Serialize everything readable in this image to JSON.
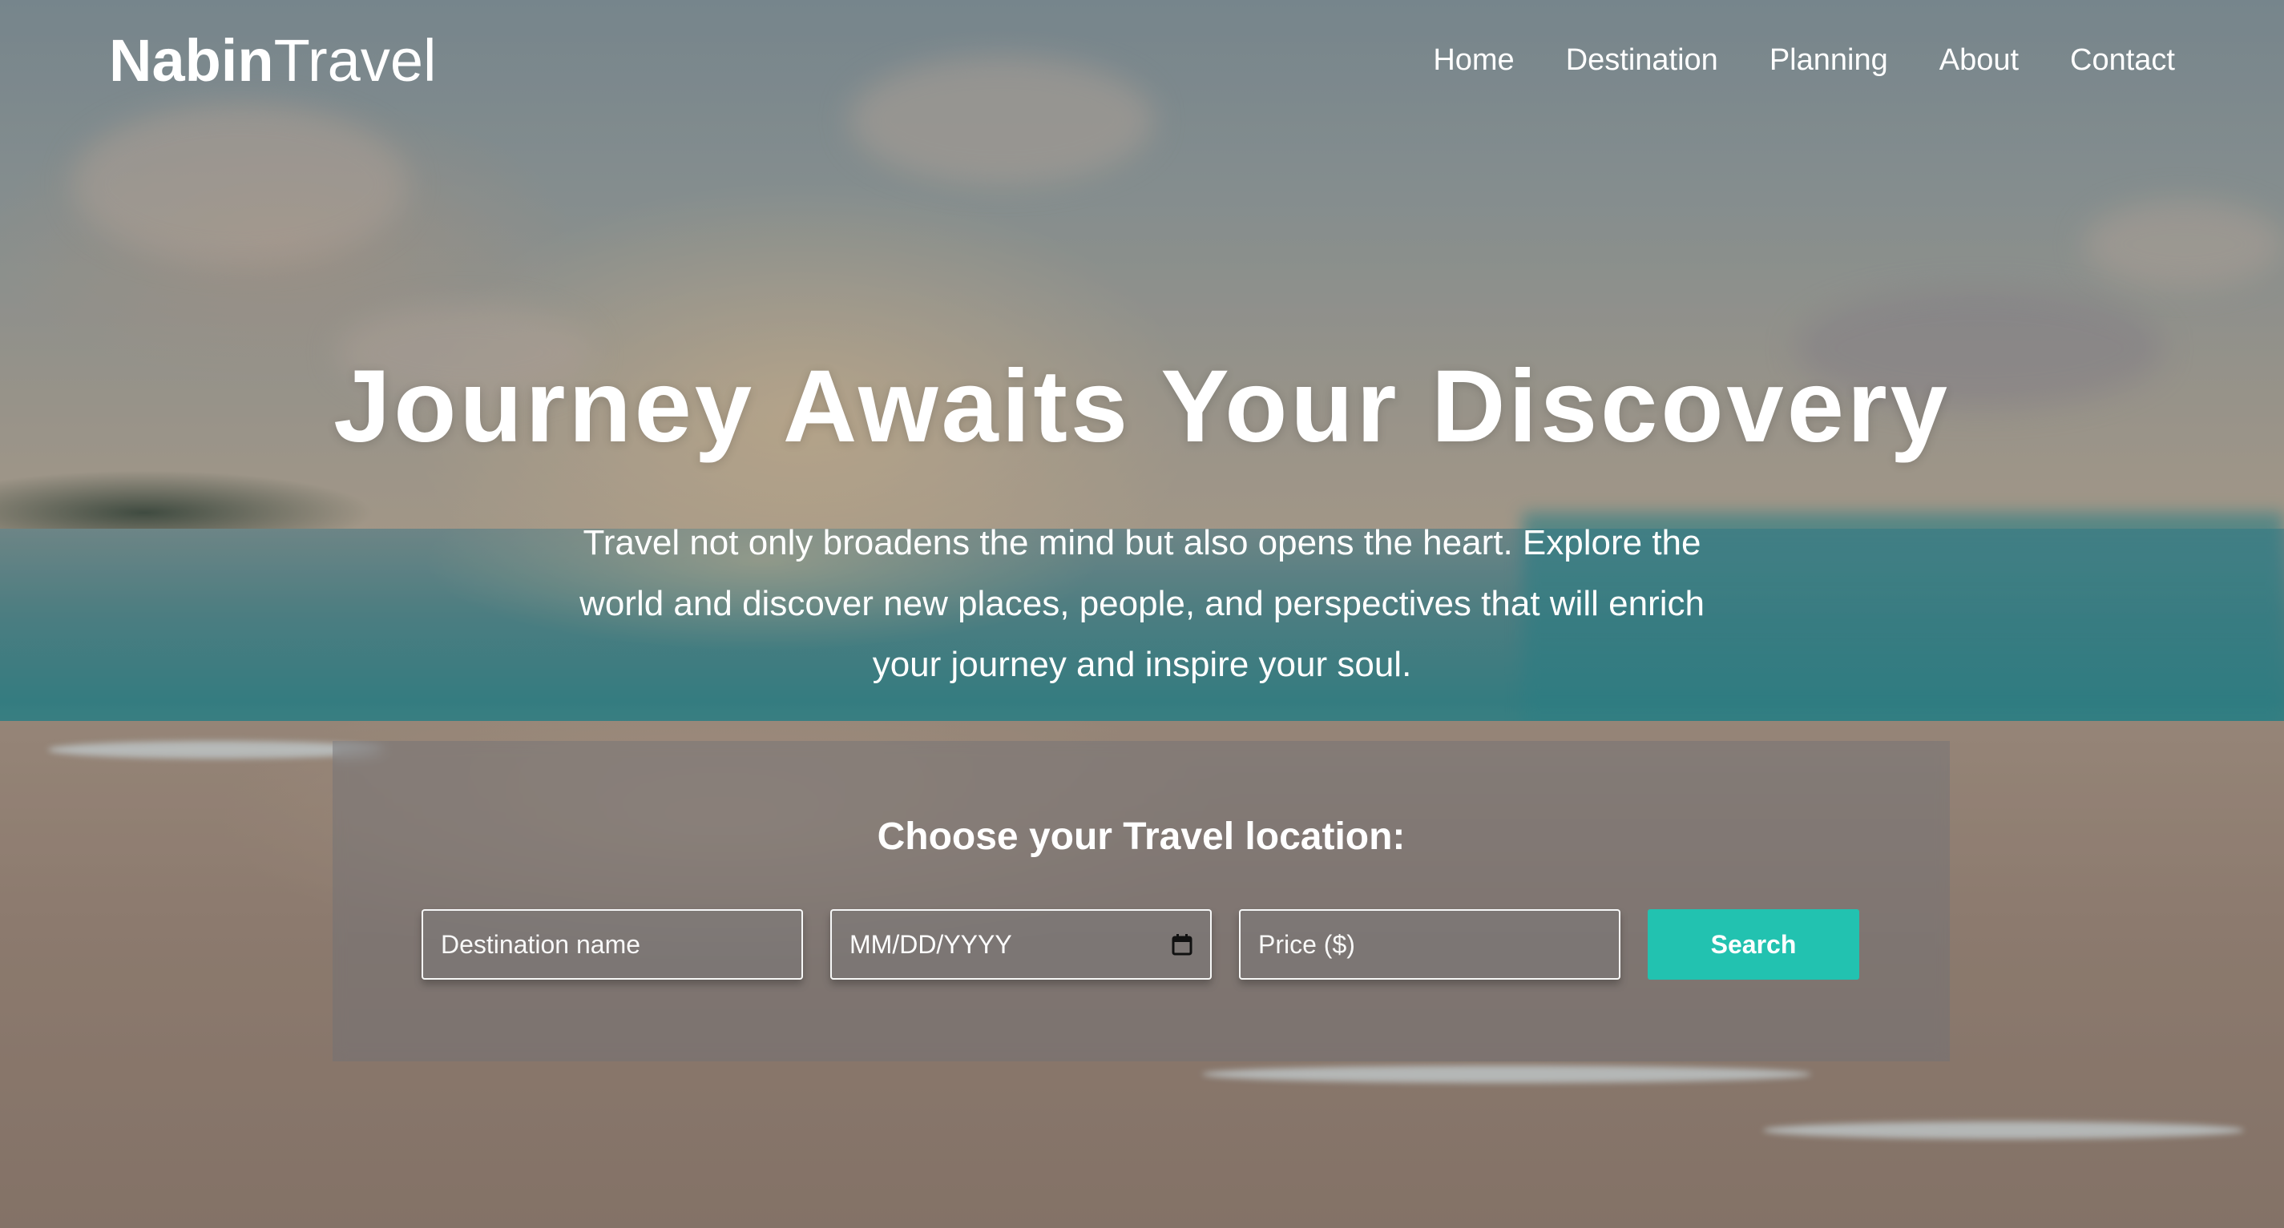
{
  "brand": {
    "bold": "Nabin",
    "light": "Travel"
  },
  "nav": {
    "items": [
      {
        "label": "Home"
      },
      {
        "label": "Destination"
      },
      {
        "label": "Planning"
      },
      {
        "label": "About"
      },
      {
        "label": "Contact"
      }
    ]
  },
  "hero": {
    "title": "Journey Awaits Your Discovery",
    "text": "Travel not only broadens the mind but also opens the heart. Explore the world and discover new places, people, and perspectives that will enrich your journey and inspire your soul."
  },
  "search": {
    "title": "Choose your Travel location:",
    "destination_placeholder": "Destination name",
    "date_placeholder": "MM/DD/YYYY",
    "price_placeholder": "Price ($)",
    "button_label": "Search"
  },
  "colors": {
    "accent": "#22c2b0",
    "text": "#ffffff"
  },
  "icons": {
    "date_field": "calendar-icon"
  }
}
